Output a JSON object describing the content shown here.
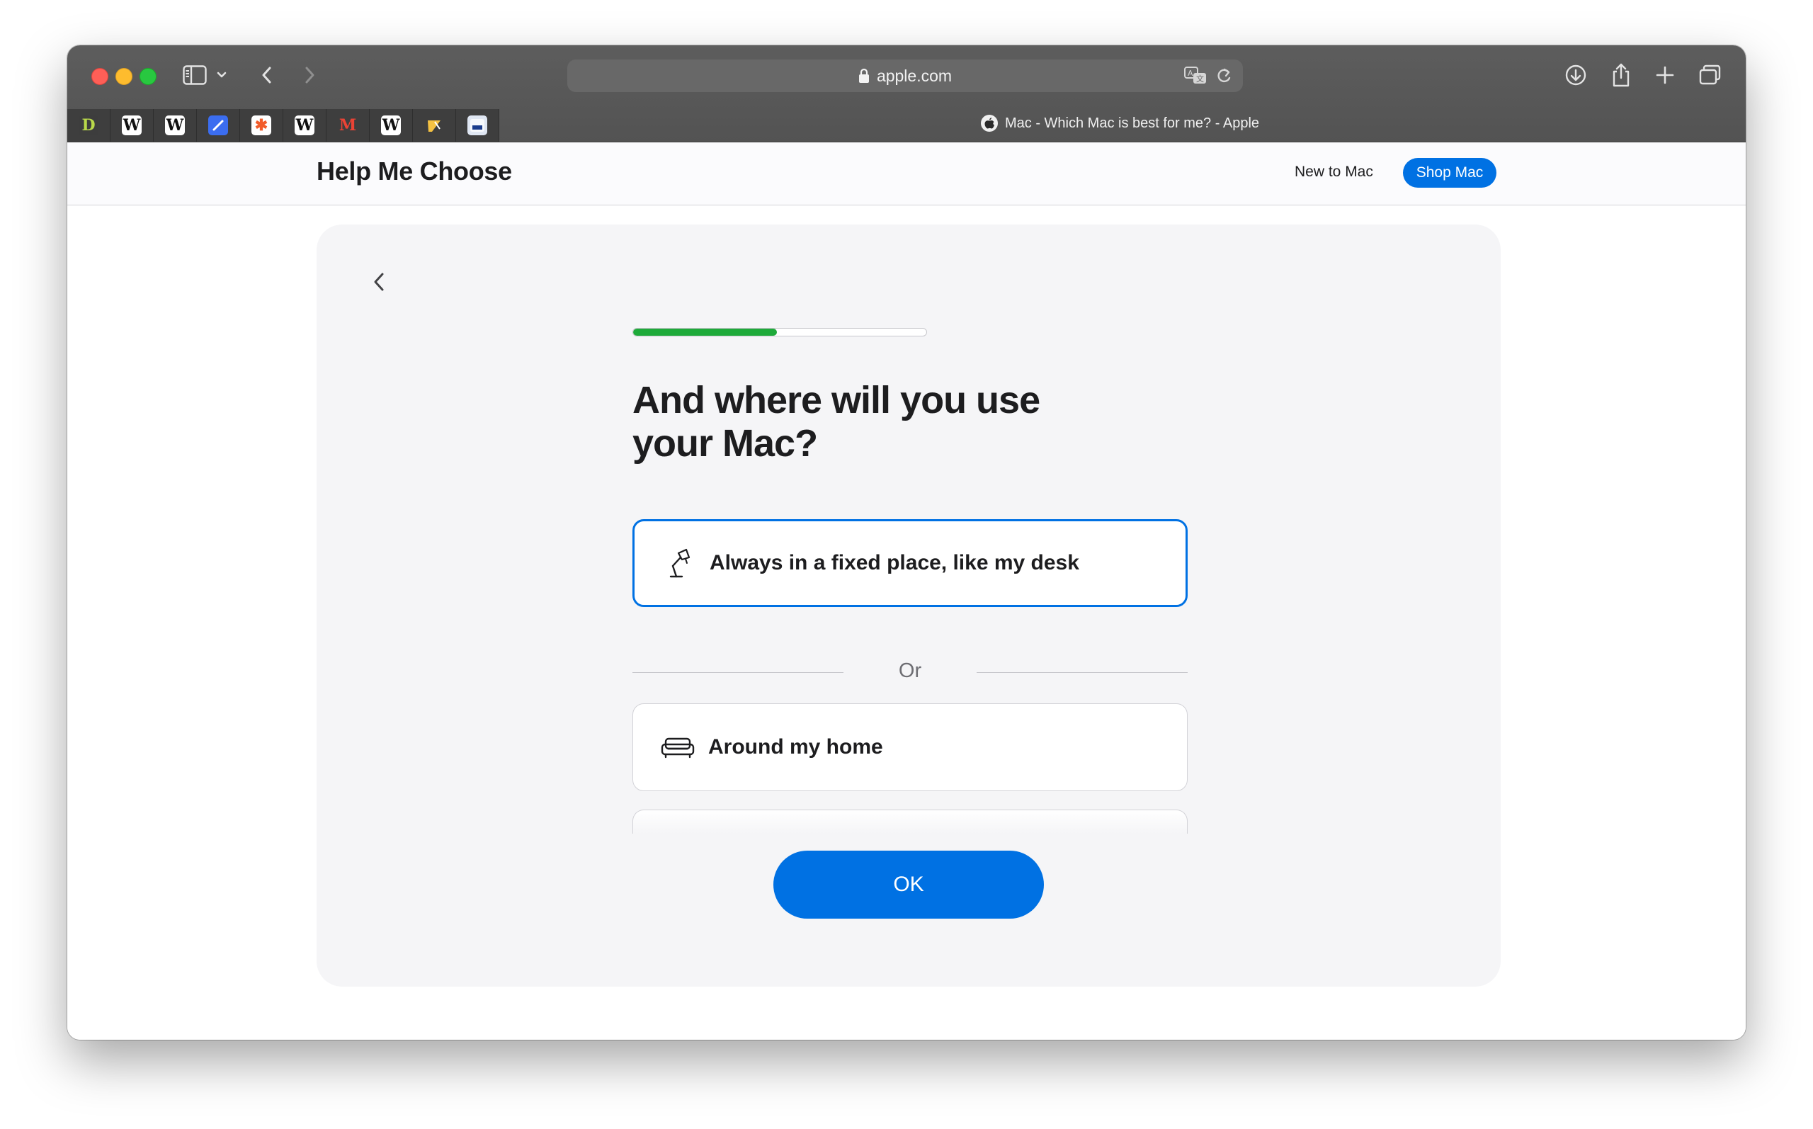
{
  "browser": {
    "address": "apple.com",
    "tab_title": "Mac - Which Mac is best for me? - Apple",
    "favorites": [
      {
        "icon": "d-app-icon",
        "glyph": "D",
        "bg": "#3d3d3d",
        "fg": "#b9d94a"
      },
      {
        "icon": "wikipedia-icon",
        "glyph": "W",
        "bg": "#ffffff",
        "fg": "#111111"
      },
      {
        "icon": "wikipedia-icon",
        "glyph": "W",
        "bg": "#ffffff",
        "fg": "#111111"
      },
      {
        "icon": "pen-app-icon",
        "glyph": "",
        "bg": "#3b6df0",
        "fg": "#ffffff"
      },
      {
        "icon": "asterisk-app-icon",
        "glyph": "✱",
        "bg": "#ffffff",
        "fg": "#f25c2a"
      },
      {
        "icon": "wikipedia-icon",
        "glyph": "W",
        "bg": "#ffffff",
        "fg": "#111111"
      },
      {
        "icon": "gmail-icon",
        "glyph": "M",
        "bg": "#3e3e3e",
        "fg": "#ea4335"
      },
      {
        "icon": "wikipedia-icon",
        "glyph": "W",
        "bg": "#ffffff",
        "fg": "#111111"
      },
      {
        "icon": "translate-app-icon",
        "glyph": "",
        "bg": "#3e3e3e",
        "fg": "#f5c242"
      },
      {
        "icon": "window-app-icon",
        "glyph": "",
        "bg": "#dfe6f2",
        "fg": "#1c3d8c"
      }
    ]
  },
  "nav": {
    "title": "Help Me Choose",
    "new_to_mac": "New to Mac",
    "shop_mac": "Shop Mac"
  },
  "quiz": {
    "progress": 0.49,
    "question": "And where will you use your Mac?",
    "options": [
      {
        "label": "Always in a fixed place, like my desk",
        "icon": "desk-lamp-icon",
        "selected": true
      },
      {
        "label": "Around my home",
        "icon": "sofa-icon",
        "selected": false
      }
    ],
    "divider_text": "Or",
    "ok_label": "OK"
  },
  "colors": {
    "accent": "#0071e3",
    "progress": "#1eaa3a",
    "card_bg": "#f5f5f7"
  }
}
